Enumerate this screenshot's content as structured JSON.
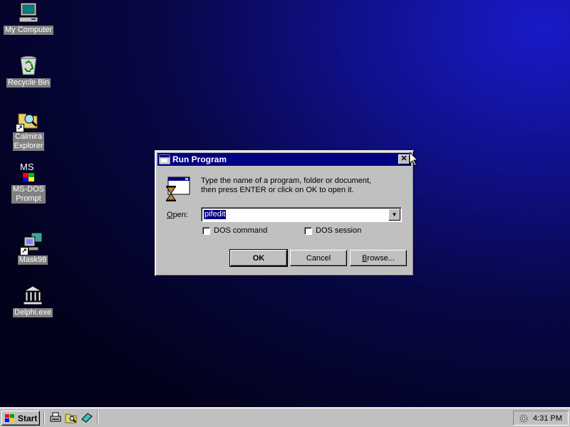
{
  "desktop": {
    "icons": [
      {
        "label": "My Computer",
        "icon": "computer-icon"
      },
      {
        "label": "Recycle Bin",
        "icon": "recycle-bin-icon"
      },
      {
        "label": "Calmira\nExplorer",
        "icon": "explorer-icon"
      },
      {
        "label": "MS-DOS\nPrompt",
        "icon": "msdos-icon",
        "glyph": "MS"
      },
      {
        "label": "Mask98",
        "icon": "mask98-icon"
      },
      {
        "label": "Delphi.exe",
        "icon": "delphi-icon"
      }
    ]
  },
  "dialog": {
    "title": "Run Program",
    "description_line1": "Type the name of a program, folder or document,",
    "description_line2": "then press ENTER or click on OK to open it.",
    "open_label_first": "O",
    "open_label_rest": "pen:",
    "open_value": "pifedit",
    "close_glyph": "✕",
    "dropdown_glyph": "▼",
    "checkbox_dos_command": {
      "label": "DOS command",
      "checked": false
    },
    "checkbox_dos_session": {
      "label": "DOS session",
      "checked": false
    },
    "ok_label": "OK",
    "cancel_label": "Cancel",
    "browse_label_first": "B",
    "browse_label_rest": "rowse..."
  },
  "taskbar": {
    "start_label": "Start",
    "clock": "4:31 PM"
  },
  "colors": {
    "desktop": "#0b0b70",
    "titlebar": "#000080",
    "face": "#c0c0c0",
    "selection": "#000080"
  }
}
